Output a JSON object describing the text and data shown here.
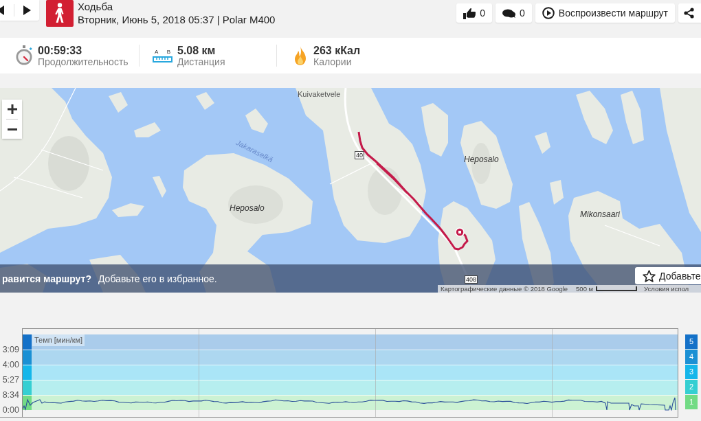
{
  "header": {
    "title": "Ходьба",
    "subtitle": "Вторник, Июнь 5, 2018 05:37 | Polar M400",
    "actions": [
      {
        "kind": "like",
        "count": "0"
      },
      {
        "kind": "comment",
        "count": "0"
      },
      {
        "kind": "play",
        "label": "Воспроизвести маршрут"
      },
      {
        "kind": "share"
      }
    ]
  },
  "summary": [
    {
      "kind": "duration",
      "value": "00:59:33",
      "label": "Продолжительность"
    },
    {
      "kind": "distance",
      "start_mark": "A",
      "end_mark": "B",
      "value": "5.08 км",
      "label": "Дистанция"
    },
    {
      "kind": "calories",
      "value": "263 кКал",
      "label": "Калории"
    }
  ],
  "map": {
    "labels": [
      {
        "kind": "settlement",
        "text": "Kuivaketvele"
      },
      {
        "kind": "water",
        "text": "Jakaraselkä"
      },
      {
        "kind": "island",
        "text": "Heposalo"
      },
      {
        "kind": "road",
        "text": "40"
      },
      {
        "kind": "island",
        "text": "Heposalo"
      },
      {
        "kind": "island",
        "text": "Mikonsaari"
      },
      {
        "kind": "road",
        "text": "408"
      }
    ],
    "promo": {
      "question": "равится маршрут?",
      "text": "Добавьте его в избранное.",
      "button": "Добавьте"
    },
    "attribution": "Картографические данные © 2018 Google",
    "scale": "500 м",
    "terms": "Условия испол"
  },
  "pace_chart": {
    "title": "Темп [мин/км]",
    "y_labels": [
      "3:09",
      "4:00",
      "5:27",
      "8:34",
      "0:00"
    ],
    "zones": [
      {
        "label": "5",
        "color": "#1471c8"
      },
      {
        "label": "4",
        "color": "#1a90d4"
      },
      {
        "label": "3",
        "color": "#14b6ea"
      },
      {
        "label": "2",
        "color": "#35cfd2"
      },
      {
        "label": "1",
        "color": "#72db85"
      }
    ]
  }
}
